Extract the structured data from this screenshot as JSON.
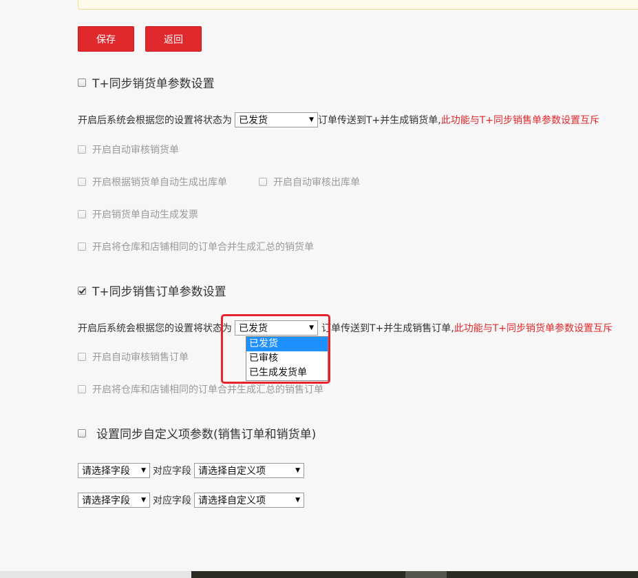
{
  "buttons": {
    "save": "保存",
    "back": "返回"
  },
  "section1": {
    "title": "T+同步销货单参数设置",
    "checked": false,
    "desc_prefix": "开启后系统会根据您的设置将状态为",
    "select_value": "已发货",
    "desc_suffix": "订单传送到T+并生成销货单,",
    "warning": "此功能与T+同步销售单参数设置互斥",
    "options": [
      "开启自动审核销货单",
      "开启根据销货单自动生成出库单",
      "开启自动审核出库单",
      "开启销货单自动生成发票",
      "开启将仓库和店铺相同的订单合并生成汇总的销货单"
    ]
  },
  "section2": {
    "title": "T+同步销售订单参数设置",
    "checked": true,
    "desc_prefix": "开启后系统会根据您的设置将状态为",
    "select_value": "已发货",
    "desc_suffix": "订单传送到T+并生成销售订单,",
    "warning": "此功能与T+同步销货单参数设置互斥",
    "dropdown_options": [
      "已发货",
      "已审核",
      "已生成发货单"
    ],
    "options": [
      "开启自动审核销售订单",
      "开启将仓库和店铺相同的订单合并生成汇总的销售订单"
    ]
  },
  "section3": {
    "title": "设置同步自定义项参数(销售订单和销货单)",
    "checked": false,
    "rows": [
      {
        "field": "请选择字段",
        "label": "对应字段",
        "custom": "请选择自定义项"
      },
      {
        "field": "请选择字段",
        "label": "对应字段",
        "custom": "请选择自定义项"
      }
    ]
  },
  "colors": {
    "primary": "#e0292d",
    "warning": "#e0292d",
    "highlight": "#1e90ff"
  }
}
